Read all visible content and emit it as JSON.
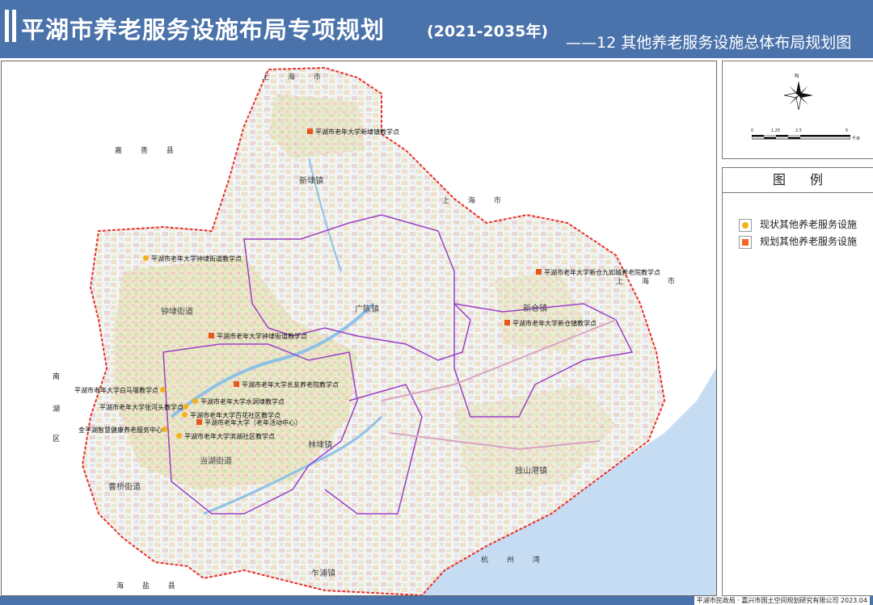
{
  "header": {
    "title": "平湖市养老服务设施布局专项规划",
    "years": "(2021-2035年)",
    "subtitle": "——12 其他养老服务设施总体布局规划图"
  },
  "colors": {
    "header_bg": "#4a72ab",
    "existing_facility": "#f5b11c",
    "planned_facility": "#e8561c",
    "boundary_city": "#e8312c",
    "boundary_town": "#9b3fc6",
    "sea": "#c6dcf2"
  },
  "north_arrow": {
    "label": "N"
  },
  "scale_bar": {
    "ticks": [
      "0",
      "1.25",
      "2.5",
      "5"
    ],
    "unit": "千米"
  },
  "legend": {
    "title": "图例",
    "items": [
      {
        "label": "现状其他养老服务设施",
        "symbol": "circle"
      },
      {
        "label": "规划其他养老服务设施",
        "symbol": "square"
      }
    ]
  },
  "map": {
    "neighbors": {
      "shanghai_top": "上 海 市",
      "jiashan": "嘉 善 县",
      "shanghai_mid": "上 海 市",
      "shanghai_right": "上 海 市",
      "nanhu": [
        "南",
        "湖",
        "区"
      ],
      "haiyan": "海 盐 县",
      "hangzhou_bay": "杭 州 湾"
    },
    "towns": {
      "xindai": "新埭镇",
      "guangchen": "广陈镇",
      "xincang": "新仓镇",
      "zhongdai": "钟埭街道",
      "danghu": "当湖街道",
      "linda": "林埭镇",
      "caoqiao": "曹桥街道",
      "dushangang": "独山港镇",
      "zhapu": "乍浦镇"
    },
    "facilities": [
      {
        "name": "平湖市老年大学新埭镇教学点",
        "type": "planned"
      },
      {
        "name": "平湖市老年大学钟埭街道教学点",
        "type": "existing"
      },
      {
        "name": "平湖市老年大学新仓九如城养老院教学点",
        "type": "planned"
      },
      {
        "name": "平湖市老年大学新仓镇教学点",
        "type": "planned"
      },
      {
        "name": "平湖市老年大学钟埭街道教学点",
        "type": "planned"
      },
      {
        "name": "平湖市老年大学长友养老院教学点",
        "type": "planned"
      },
      {
        "name": "平湖市老年大学白马堰教学点",
        "type": "existing"
      },
      {
        "name": "平湖市老年大学水洞埭教学点",
        "type": "existing"
      },
      {
        "name": "平湖市老年大学张河头教学点",
        "type": "existing"
      },
      {
        "name": "平湖市老年大学百花社区教学点",
        "type": "existing"
      },
      {
        "name": "平湖市老年大学（老年活动中心）",
        "type": "planned"
      },
      {
        "name": "金平湖智慧健康养老服务中心",
        "type": "existing"
      },
      {
        "name": "平湖市老年大学滨湖社区教学点",
        "type": "existing"
      }
    ]
  },
  "footer": {
    "credit": "平湖市民政局 · 嘉兴市国土空间规划研究有限公司 2023.04"
  }
}
